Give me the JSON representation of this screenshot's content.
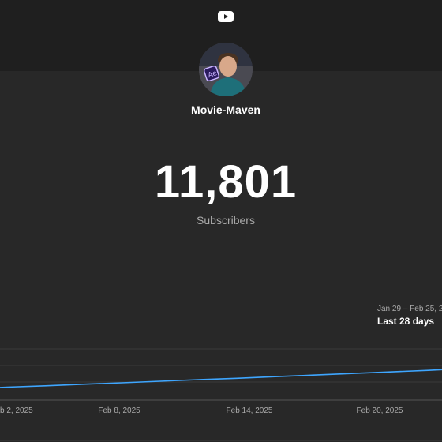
{
  "header": {
    "logo_icon": "youtube-icon",
    "logo_color": "#ffffff"
  },
  "channel": {
    "name": "Movie-Maven",
    "avatar_icon": "channel-avatar"
  },
  "stats": {
    "subscriber_count": "11,801",
    "subscriber_label": "Subscribers"
  },
  "period": {
    "range": "Jan 29 – Feb 25, 2025",
    "label": "Last 28 days"
  },
  "chart_data": {
    "type": "line",
    "x_tick_labels": [
      "Feb 2, 2025",
      "Feb 8, 2025",
      "Feb 14, 2025",
      "Feb 20, 2025"
    ],
    "x": [
      "Jan 29",
      "Jan 31",
      "Feb 2",
      "Feb 4",
      "Feb 6",
      "Feb 8",
      "Feb 10",
      "Feb 12",
      "Feb 14",
      "Feb 16",
      "Feb 18",
      "Feb 20",
      "Feb 22",
      "Feb 24",
      "Feb 25"
    ],
    "series": [
      {
        "color": "#3ea6ff",
        "values": [
          11500,
          11514,
          11526,
          11540,
          11552,
          11566,
          11580,
          11592,
          11606,
          11620,
          11634,
          11648,
          11662,
          11678,
          11801
        ]
      }
    ],
    "ylim": [
      11400,
      11850
    ],
    "grid": true
  }
}
